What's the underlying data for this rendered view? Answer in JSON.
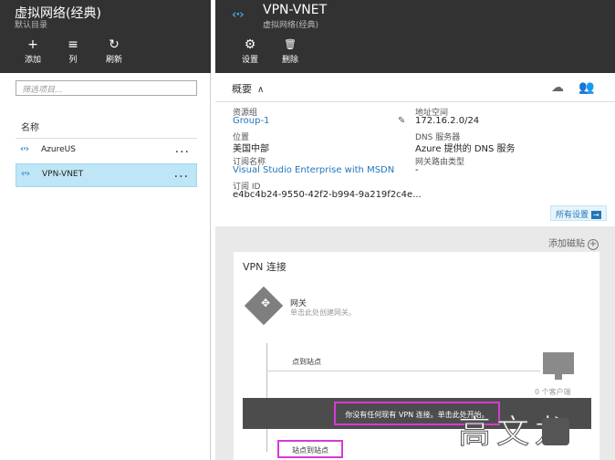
{
  "left": {
    "title": "虚拟网络(经典)",
    "subtitle": "默认目录",
    "toolbar": [
      {
        "icon": "+",
        "label": "添加"
      },
      {
        "icon": "≡",
        "label": "列"
      },
      {
        "icon": "↻",
        "label": "刷新"
      }
    ],
    "filter_placeholder": "筛选项目...",
    "column_header": "名称",
    "rows": [
      {
        "icon": "‹·›",
        "name": "AzureUS",
        "more": "..."
      },
      {
        "icon": "‹·›",
        "name": "VPN-VNET",
        "more": "..."
      }
    ]
  },
  "right": {
    "icon": "‹·›",
    "title": "VPN-VNET",
    "subtitle": "虚拟网络(经典)",
    "toolbar": [
      {
        "icon": "⚙",
        "label": "设置"
      },
      {
        "icon": "🗑",
        "label": "删除"
      }
    ],
    "essentials": {
      "header": "概要",
      "chevron": "∧",
      "resource_group_label": "资源组",
      "resource_group_value": "Group-1",
      "location_label": "位置",
      "location_value": "美国中部",
      "subscription_name_label": "订阅名称",
      "subscription_name_value": "Visual Studio Enterprise with MSDN",
      "subscription_id_label": "订阅 ID",
      "subscription_id_value": "e4bc4b24-9550-42f2-b994-9a219f2c4e...",
      "address_space_label": "地址空间",
      "address_space_value": "172.16.2.0/24",
      "dns_label": "DNS 服务器",
      "dns_value": "Azure 提供的 DNS 服务",
      "gateway_type_label": "网关路由类型",
      "gateway_type_value": "-",
      "all_settings": "所有设置",
      "all_settings_arrow": "→"
    },
    "add_tile": "添加磁贴",
    "add_tile_icon": "+",
    "vpn_tile": {
      "title": "VPN 连接",
      "gateway_label": "网关",
      "gateway_sub": "单击此处创建网关。",
      "point_to_site": "点到站点",
      "clients": "0 个客户端",
      "banner": "你没有任何现有 VPN 连接。单击此处开始。",
      "site_to_site": "站点到站点"
    }
  },
  "watermark": "高文龙",
  "colors": {
    "header_bg": "#323232",
    "link": "#2276bb",
    "selected_row": "#bfe6f6",
    "highlight_border": "#d63bd6"
  }
}
